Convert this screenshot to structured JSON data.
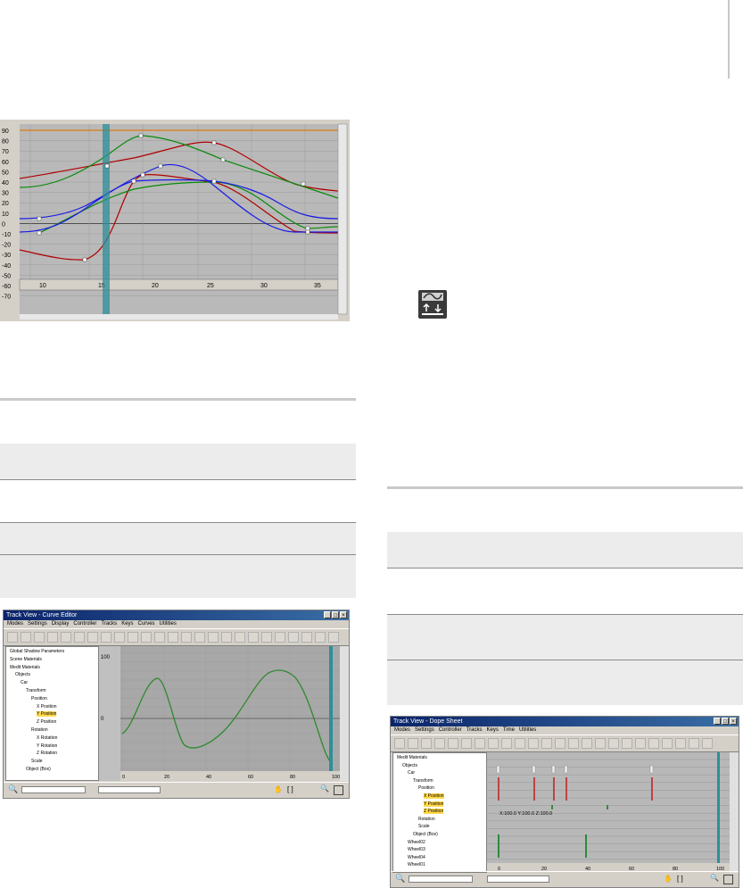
{
  "page": {
    "background": "#ffffff"
  },
  "curve_graph": {
    "y_ticks": [
      "90",
      "80",
      "70",
      "60",
      "50",
      "40",
      "30",
      "20",
      "10",
      "0",
      "-10",
      "-20",
      "-30",
      "-40",
      "-50",
      "-60",
      "-70"
    ],
    "x_ticks": [
      "10",
      "15",
      "20",
      "25",
      "30",
      "35"
    ],
    "colors": {
      "grid_bg": "#b9b9b9",
      "red": "#b00000",
      "green": "#0a8a0a",
      "blue": "#1a1ae6",
      "orange": "#e07a10",
      "cursor": "#2d8f9a"
    }
  },
  "icon": {
    "name": "curve-editor-icon"
  },
  "curve_editor": {
    "title": "Track View - Curve Editor",
    "menu": [
      "Modes",
      "Settings",
      "Display",
      "Controller",
      "Tracks",
      "Keys",
      "Curves",
      "Utilities"
    ],
    "tree": [
      {
        "label": "Global Shadow Parameters",
        "indent": 0,
        "hl": false
      },
      {
        "label": "Scene Materials",
        "indent": 0,
        "hl": false
      },
      {
        "label": "Medit Materials",
        "indent": 0,
        "hl": false
      },
      {
        "label": "Objects",
        "indent": 1,
        "hl": false
      },
      {
        "label": "Car",
        "indent": 2,
        "hl": false
      },
      {
        "label": "Transform",
        "indent": 3,
        "hl": false
      },
      {
        "label": "Position",
        "indent": 4,
        "hl": false
      },
      {
        "label": "X Position",
        "indent": 5,
        "hl": false
      },
      {
        "label": "Y Position",
        "indent": 5,
        "hl": true
      },
      {
        "label": "Z Position",
        "indent": 5,
        "hl": false
      },
      {
        "label": "Rotation",
        "indent": 4,
        "hl": false
      },
      {
        "label": "X Rotation",
        "indent": 5,
        "hl": false
      },
      {
        "label": "Y Rotation",
        "indent": 5,
        "hl": false
      },
      {
        "label": "Z Rotation",
        "indent": 5,
        "hl": false
      },
      {
        "label": "Scale",
        "indent": 4,
        "hl": false
      },
      {
        "label": "Object (Box)",
        "indent": 3,
        "hl": false
      }
    ],
    "y_labels": [
      "100",
      "0"
    ],
    "x_labels": [
      "0",
      "20",
      "40",
      "60",
      "80",
      "100"
    ]
  },
  "dope_sheet": {
    "title": "Track View - Dope Sheet",
    "menu": [
      "Modes",
      "Settings",
      "Controller",
      "Tracks",
      "Keys",
      "Time",
      "Utilities"
    ],
    "tree": [
      {
        "label": "Medit Materials",
        "indent": 0,
        "hl": false
      },
      {
        "label": "Objects",
        "indent": 1,
        "hl": false
      },
      {
        "label": "Car",
        "indent": 2,
        "hl": false
      },
      {
        "label": "Transform",
        "indent": 3,
        "hl": false
      },
      {
        "label": "Position",
        "indent": 4,
        "hl": false
      },
      {
        "label": "X Position",
        "indent": 5,
        "hl": true
      },
      {
        "label": "Y Position",
        "indent": 5,
        "hl": true
      },
      {
        "label": "Z Position",
        "indent": 5,
        "hl": true
      },
      {
        "label": "Rotation",
        "indent": 4,
        "hl": false
      },
      {
        "label": "Scale",
        "indent": 4,
        "hl": false
      },
      {
        "label": "Object (Box)",
        "indent": 3,
        "hl": false
      },
      {
        "label": "Wheel02",
        "indent": 2,
        "hl": false
      },
      {
        "label": "Wheel03",
        "indent": 2,
        "hl": false
      },
      {
        "label": "Wheel04",
        "indent": 2,
        "hl": false
      },
      {
        "label": "Wheel01",
        "indent": 2,
        "hl": false
      }
    ],
    "readout": "X:100.0 Y:100.0 Z:100.0",
    "x_labels": [
      "0",
      "20",
      "40",
      "60",
      "80",
      "100"
    ]
  }
}
